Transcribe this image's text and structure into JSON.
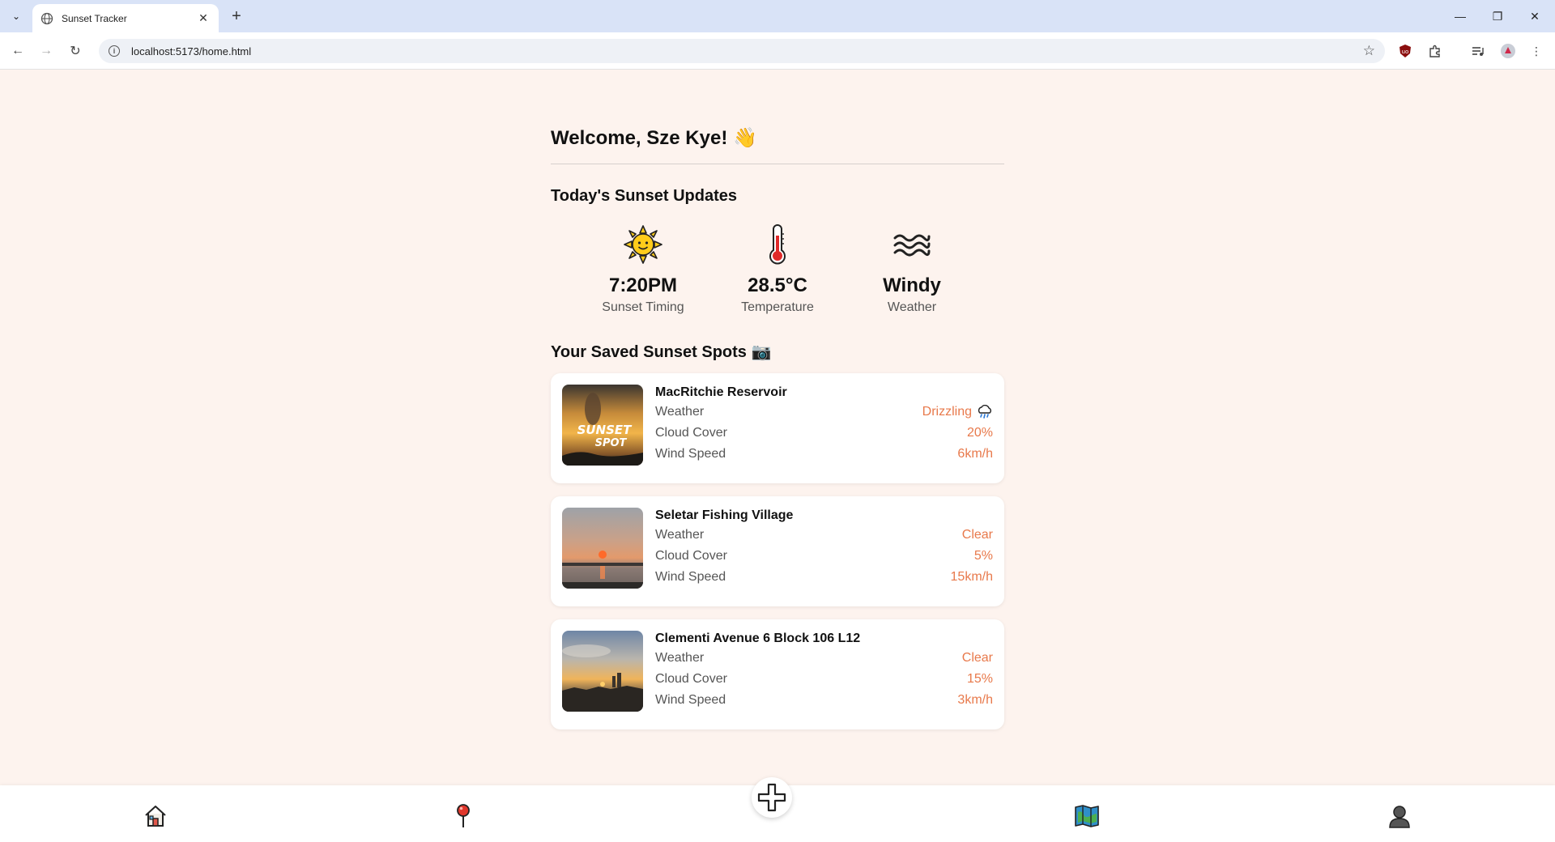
{
  "browser": {
    "tab_title": "Sunset Tracker",
    "url": "localhost:5173/home.html"
  },
  "page": {
    "welcome": "Welcome, Sze Kye! 👋",
    "updates_title": "Today's Sunset Updates",
    "updates": [
      {
        "value": "7:20PM",
        "label": "Sunset Timing",
        "icon": "sun-icon"
      },
      {
        "value": "28.5°C",
        "label": "Temperature",
        "icon": "thermometer-icon"
      },
      {
        "value": "Windy",
        "label": "Weather",
        "icon": "wind-waves-icon"
      }
    ],
    "spots_title": "Your Saved Sunset Spots 📷",
    "spots": [
      {
        "name": "MacRitchie Reservoir",
        "weather_label": "Weather",
        "weather": "Drizzling",
        "weather_icon": "rain-cloud-icon",
        "cloud_label": "Cloud Cover",
        "cloud": "20%",
        "wind_label": "Wind Speed",
        "wind": "6km/h",
        "thumb_text_1": "SUNSET",
        "thumb_text_2": "SPOT"
      },
      {
        "name": "Seletar Fishing Village",
        "weather_label": "Weather",
        "weather": "Clear",
        "cloud_label": "Cloud Cover",
        "cloud": "5%",
        "wind_label": "Wind Speed",
        "wind": "15km/h"
      },
      {
        "name": "Clementi Avenue 6 Block 106 L12",
        "weather_label": "Weather",
        "weather": "Clear",
        "cloud_label": "Cloud Cover",
        "cloud": "15%",
        "wind_label": "Wind Speed",
        "wind": "3km/h"
      }
    ]
  },
  "bottom_nav": {
    "items": [
      "home-icon",
      "pin-icon",
      "add-icon",
      "map-book-icon",
      "profile-icon"
    ]
  },
  "colors": {
    "accent": "#e8794b",
    "background": "#fdf3ee"
  }
}
